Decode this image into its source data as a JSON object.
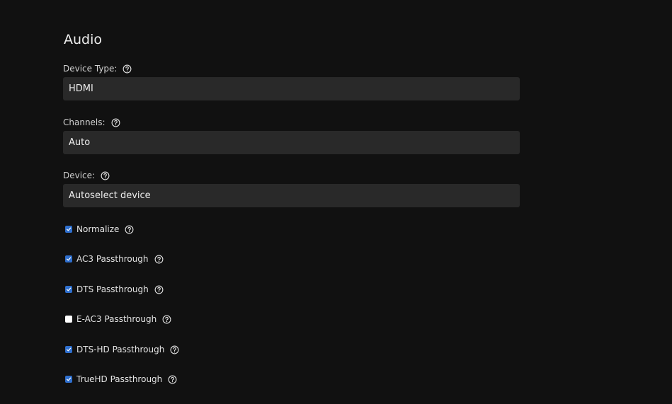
{
  "section": {
    "title": "Audio"
  },
  "fields": {
    "device_type": {
      "label": "Device Type:",
      "value": "HDMI"
    },
    "channels": {
      "label": "Channels:",
      "value": "Auto"
    },
    "device": {
      "label": "Device:",
      "value": "Autoselect device"
    }
  },
  "options": {
    "normalize": {
      "label": "Normalize",
      "checked": true
    },
    "ac3": {
      "label": "AC3 Passthrough",
      "checked": true
    },
    "dts": {
      "label": "DTS Passthrough",
      "checked": true
    },
    "eac3": {
      "label": "E-AC3 Passthrough",
      "checked": false
    },
    "dtshd": {
      "label": "DTS-HD Passthrough",
      "checked": true
    },
    "truehd": {
      "label": "TrueHD Passthrough",
      "checked": true
    }
  },
  "icons": {
    "help": "question-circle-icon",
    "check": "checkmark-icon"
  },
  "colors": {
    "background": "#111111",
    "field_bg": "#292929",
    "accent": "#2f6fcd"
  }
}
